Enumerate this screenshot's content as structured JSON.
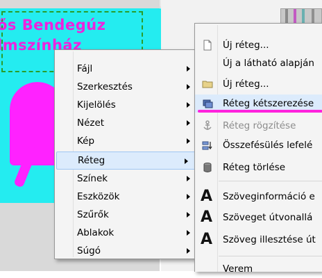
{
  "canvas": {
    "line1": "ős Bendegúz",
    "line2": "lmszínház"
  },
  "context_menu": {
    "items": [
      {
        "label": "Fájl",
        "has_submenu": true
      },
      {
        "label": "Szerkesztés",
        "has_submenu": true
      },
      {
        "label": "Kijelölés",
        "has_submenu": true
      },
      {
        "label": "Nézet",
        "has_submenu": true
      },
      {
        "label": "Kép",
        "has_submenu": true
      },
      {
        "label": "Réteg",
        "has_submenu": true,
        "active": true
      },
      {
        "label": "Színek",
        "has_submenu": true
      },
      {
        "label": "Eszközök",
        "has_submenu": true
      },
      {
        "label": "Szűrők",
        "has_submenu": true
      },
      {
        "label": "Ablakok",
        "has_submenu": true
      },
      {
        "label": "Súgó",
        "has_submenu": true
      }
    ]
  },
  "submenu": {
    "items": [
      {
        "label": "Új réteg...",
        "icon": "new-page-icon"
      },
      {
        "label": "Új a látható alapján",
        "icon": ""
      },
      {
        "label": "Új réteg...",
        "icon": "folder-icon"
      },
      {
        "label": "Réteg kétszerezése",
        "icon": "duplicate-layer-icon",
        "highlight": true
      },
      {
        "label": "Réteg rögzítése",
        "icon": "anchor-icon",
        "disabled": true
      },
      {
        "label": "Összefésülés lefelé",
        "icon": "merge-down-icon"
      },
      {
        "label": "Réteg törlése",
        "icon": "delete-layer-icon"
      },
      {
        "label": "Szöveginformáció e",
        "icon": "text-tool-icon"
      },
      {
        "label": "Szöveget útvonallá",
        "icon": "text-tool-icon"
      },
      {
        "label": "Szöveg illesztése út",
        "icon": "text-tool-icon"
      },
      {
        "label": "Verem",
        "icon": ""
      }
    ]
  },
  "colors": {
    "canvas": "#24ecf0",
    "text": "#ee22dd",
    "highlight_mark": "#ff22dd",
    "menu_active": "#dcebfc"
  }
}
